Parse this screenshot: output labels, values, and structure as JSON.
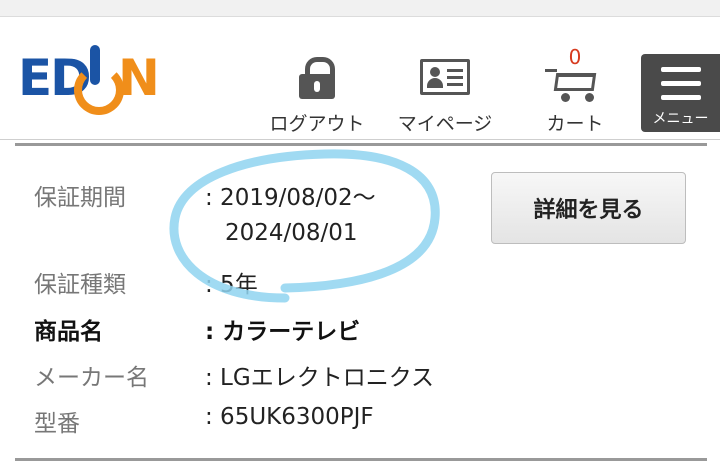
{
  "header": {
    "logo_text_left": "ED",
    "logo_text_right": "N",
    "logout_label": "ログアウト",
    "mypage_label": "マイページ",
    "cart_label": "カート",
    "cart_count": "0",
    "menu_label": "メニュー"
  },
  "warranty": {
    "period_label": "保証期間",
    "period_value_line1": ": 2019/08/02〜",
    "period_value_line2": "2024/08/01",
    "type_label": "保証種類",
    "type_value": ": 5年",
    "product_label": "商品名",
    "product_value": ": カラーテレビ",
    "maker_label": "メーカー名",
    "maker_value": ": LGエレクトロニクス",
    "model_label": "型番",
    "model_value": ": 65UK6300PJF",
    "details_button": "詳細を見る"
  },
  "colors": {
    "logo_blue": "#1b54a5",
    "logo_orange": "#f08e1a",
    "annotation_circle": "#8fd3f0",
    "cart_badge": "#d73a1e"
  },
  "icons": [
    "lock-icon",
    "member-card-icon",
    "cart-icon",
    "hamburger-menu-icon"
  ]
}
